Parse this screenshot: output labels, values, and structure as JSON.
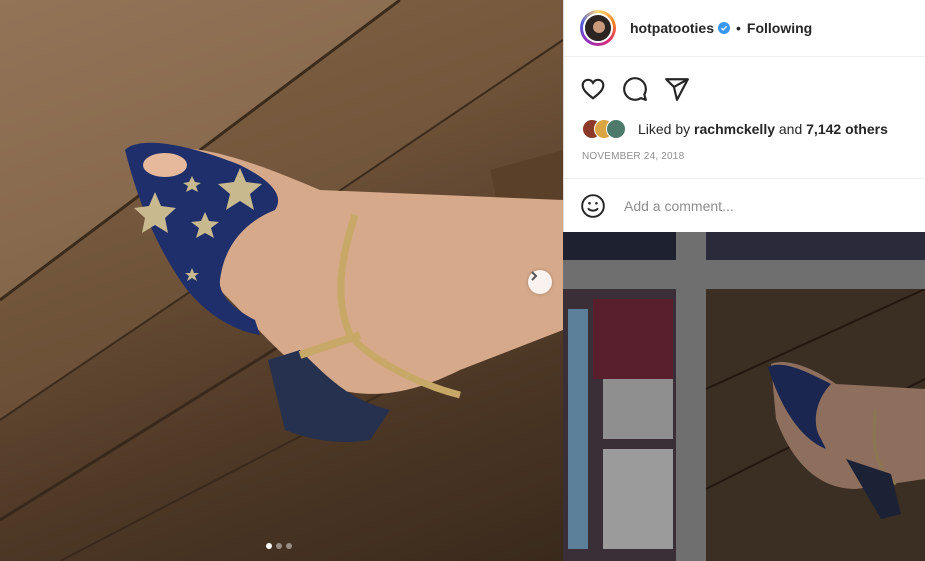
{
  "post": {
    "username": "hotpatooties",
    "separator": "•",
    "follow_state": "Following",
    "liked_by_prefix": "Liked by",
    "liked_by_user": "rachmckelly",
    "liked_by_joiner": "and",
    "liked_by_others": "7,142 others",
    "date": "NOVEMBER 24, 2018",
    "comment_placeholder": "Add a comment...",
    "carousel": {
      "total": 3,
      "current": 1
    }
  },
  "icons": {
    "like": "heart-icon",
    "comment": "comment-bubble-icon",
    "share": "paper-plane-icon",
    "emoji": "smiley-icon",
    "verified": "verified-badge-icon",
    "next": "chevron-right-icon"
  },
  "colors": {
    "verified_blue": "#3897f0",
    "meta_gray": "#8e8e8e",
    "text": "#262626",
    "divider": "#efefef"
  }
}
